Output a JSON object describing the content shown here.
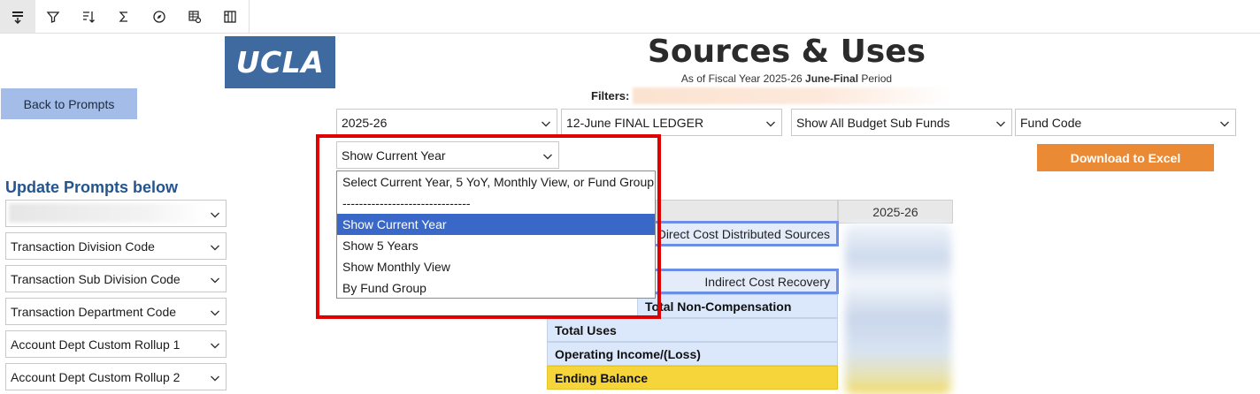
{
  "toolbar": {
    "icons": [
      "insert-row-icon",
      "filter-icon",
      "sort-icon",
      "sum-icon",
      "explore-icon",
      "table-settings-icon",
      "pivot-icon"
    ]
  },
  "logo": {
    "text": "UCLA"
  },
  "header": {
    "title": "Sources & Uses",
    "subtitle_prefix": "As of Fiscal Year 2025-26 ",
    "subtitle_bold": "June-Final",
    "subtitle_suffix": " Period",
    "filters_label": "Filters:"
  },
  "back_button": "Back to Prompts",
  "selects": {
    "year": "2025-26",
    "ledger": "12-June FINAL LEDGER",
    "budget_sub_funds": "Show All Budget Sub Funds",
    "fund_code": "Fund Code",
    "view": "Show Current Year"
  },
  "download_button": "Download to Excel",
  "update_prompts_title": "Update Prompts below",
  "prompts": [
    "Transaction Division Code",
    "Transaction Sub Division Code",
    "Transaction Department Code",
    "Account Dept Custom Rollup 1",
    "Account Dept Custom Rollup 2"
  ],
  "dropdown_options": [
    "Select Current Year, 5 YoY, Monthly View, or Fund Group",
    "-------------------------------",
    "Show Current Year",
    "Show 5 Years",
    "Show Monthly View",
    "By Fund Group"
  ],
  "selected_option": "Show Current Year",
  "table": {
    "year_header": "2025-26",
    "cells": {
      "direct_cost": "Direct Cost Distributed Sources",
      "indirect_cost": "Indirect Cost Recovery",
      "total_non_comp": "Total Non-Compensation",
      "total_uses": "Total Uses",
      "operating_income": "Operating Income/(Loss)",
      "ending_balance": "Ending Balance"
    }
  },
  "colors": {
    "logo_bg": "#3f6aa0",
    "back_button_bg": "#a3bde8",
    "excel_button_bg": "#ea8a34",
    "highlight_red": "#e00000",
    "selected_option_bg": "#3a68c9",
    "ending_balance_bg": "#f5d53a"
  }
}
